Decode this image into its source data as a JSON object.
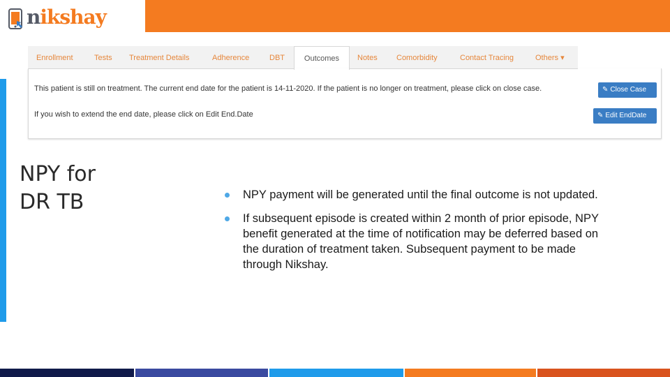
{
  "brand": {
    "logo_prefix": "n",
    "logo_rest": "ikshay",
    "accent": "#f47b20",
    "accent_blue": "#1f9bea"
  },
  "ui": {
    "tabs": [
      {
        "label": "Enrollment"
      },
      {
        "label": "Tests"
      },
      {
        "label": "Treatment Details"
      },
      {
        "label": "Adherence"
      },
      {
        "label": "DBT"
      },
      {
        "label": "Outcomes"
      },
      {
        "label": "Notes"
      },
      {
        "label": "Comorbidity"
      },
      {
        "label": "Contact Tracing"
      },
      {
        "label": "Others ▾"
      }
    ],
    "active_tab": "Outcomes",
    "message_close": "This patient is still on treatment. The current end date for the patient is 14-11-2020. If the patient is no longer on treatment, please click on close case.",
    "message_extend": "If you wish to extend the end date, please click on Edit End.Date",
    "close_button": "Close Case",
    "edit_button": "Edit EndDate"
  },
  "slide": {
    "title_line1": "NPY for",
    "title_line2": "DR TB",
    "bullets": [
      "NPY payment will be generated until the final outcome is not updated.",
      "If subsequent episode is created within 2 month of prior episode, NPY benefit generated at the time of notification may be deferred based on the duration of treatment taken. Subsequent payment to be made through Nikshay."
    ]
  },
  "footer_colors": [
    "#101a4a",
    "#3a4aa0",
    "#1f9bea",
    "#f47b20",
    "#d9531e"
  ]
}
